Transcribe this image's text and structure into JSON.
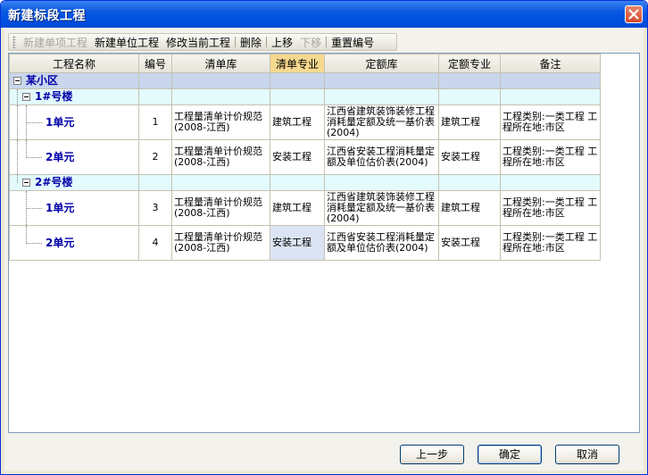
{
  "window": {
    "title": "新建标段工程"
  },
  "toolbar": {
    "items": [
      {
        "label": "新建单项工程",
        "enabled": false
      },
      {
        "label": "新建单位工程",
        "enabled": true
      },
      {
        "label": "修改当前工程",
        "enabled": true
      },
      {
        "label": "删除",
        "enabled": true
      },
      {
        "label": "上移",
        "enabled": true
      },
      {
        "label": "下移",
        "enabled": false
      },
      {
        "label": "重置编号",
        "enabled": true
      }
    ]
  },
  "table": {
    "columns": [
      "工程名称",
      "编号",
      "清单库",
      "清单专业",
      "定额库",
      "定额专业",
      "备注"
    ],
    "highlighted_column": "清单专业",
    "root": "某小区",
    "groups": [
      {
        "name": "1#号楼",
        "rows": [
          {
            "name": "1单元",
            "no": "1",
            "bill_lib": "工程量清单计价规范(2008-江西)",
            "bill_major": "建筑工程",
            "quota_lib": "江西省建筑装饰装修工程消耗量定额及统一基价表(2004)",
            "quota_major": "建筑工程",
            "remark": "工程类别:一类工程 工程所在地:市区"
          },
          {
            "name": "2单元",
            "no": "2",
            "bill_lib": "工程量清单计价规范(2008-江西)",
            "bill_major": "安装工程",
            "quota_lib": "江西省安装工程消耗量定额及单位估价表(2004)",
            "quota_major": "安装工程",
            "remark": "工程类别:一类工程 工程所在地:市区"
          }
        ]
      },
      {
        "name": "2#号楼",
        "rows": [
          {
            "name": "1单元",
            "no": "3",
            "bill_lib": "工程量清单计价规范(2008-江西)",
            "bill_major": "建筑工程",
            "quota_lib": "江西省建筑装饰装修工程消耗量定额及统一基价表(2004)",
            "quota_major": "建筑工程",
            "remark": "工程类别:一类工程 工程所在地:市区"
          },
          {
            "name": "2单元",
            "no": "4",
            "bill_lib": "工程量清单计价规范(2008-江西)",
            "bill_major": "安装工程",
            "quota_lib": "江西省安装工程消耗量定额及单位估价表(2004)",
            "quota_major": "安装工程",
            "remark": "工程类别:一类工程 工程所在地:市区"
          }
        ]
      }
    ]
  },
  "buttons": {
    "prev": "上一步",
    "ok": "确定",
    "cancel": "取消"
  },
  "colors": {
    "title_bar": "#0054e3",
    "highlight_header": "#f6d88f",
    "group_row": "#c9d6ec",
    "subgroup_row": "#e3fbfd",
    "tree_text": "#0000a8"
  }
}
